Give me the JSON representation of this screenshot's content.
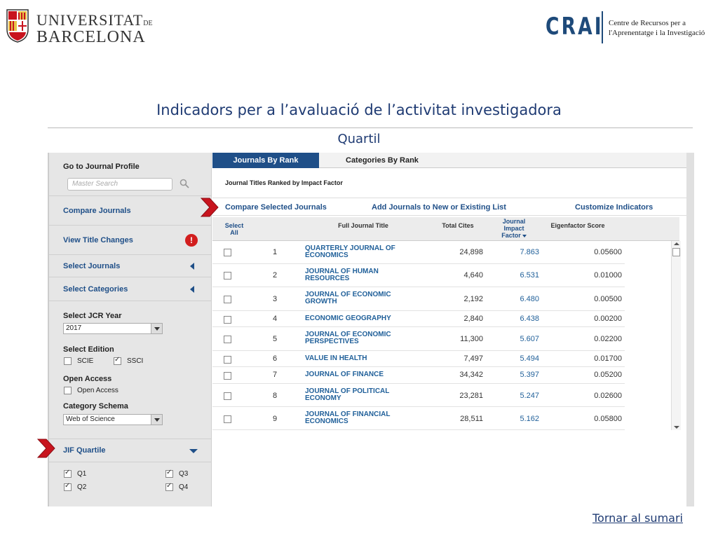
{
  "header": {
    "ub_line1": "UNIVERSITAT",
    "ub_de": "DE",
    "ub_line2": "BARCELONA",
    "crai_mark": "CRAI",
    "crai_line1": "Centre de Recursos per a",
    "crai_line2": "l'Aprenentatge i la Investigació"
  },
  "slide": {
    "title": "Indicadors per a l’avaluació de l’activitat investigadora",
    "subtitle": "Quartil",
    "back_link": "Tornar al sumari"
  },
  "sidebar": {
    "go_to_profile": "Go to Journal Profile",
    "search_placeholder": "Master Search",
    "compare_journals": "Compare Journals",
    "view_title_changes": "View Title Changes",
    "alert_glyph": "!",
    "select_journals": "Select Journals",
    "select_categories": "Select Categories",
    "jcr_year_label": "Select JCR Year",
    "jcr_year_value": "2017",
    "edition_label": "Select Edition",
    "edition_options": [
      {
        "label": "SCIE",
        "checked": false
      },
      {
        "label": "SSCI",
        "checked": true
      }
    ],
    "open_access_label": "Open Access",
    "open_access_option": "Open Access",
    "category_schema_label": "Category Schema",
    "category_schema_value": "Web of Science",
    "jif_quartile": "JIF Quartile",
    "quartiles": [
      {
        "label": "Q1",
        "checked": true
      },
      {
        "label": "Q3",
        "checked": true
      },
      {
        "label": "Q2",
        "checked": true
      },
      {
        "label": "Q4",
        "checked": true
      }
    ]
  },
  "main": {
    "tab_active": "Journals By Rank",
    "tab_other": "Categories By Rank",
    "ranked_caption": "Journal Titles Ranked by Impact Factor",
    "actions": {
      "compare": "Compare Selected Journals",
      "add": "Add Journals to New or Existing List",
      "customize": "Customize Indicators"
    },
    "columns": {
      "select_line1": "Select",
      "select_line2": "All",
      "title": "Full Journal Title",
      "cites": "Total Cites",
      "jif_line1": "Journal",
      "jif_line2": "Impact",
      "jif_line3": "Factor",
      "eigen": "Eigenfactor Score"
    },
    "rows": [
      {
        "rank": "1",
        "title_line1": "QUARTERLY JOURNAL OF",
        "title_line2": "ECONOMICS",
        "cites": "24,898",
        "jif": "7.863",
        "eigen": "0.05600"
      },
      {
        "rank": "2",
        "title_line1": "JOURNAL OF HUMAN",
        "title_line2": "RESOURCES",
        "cites": "4,640",
        "jif": "6.531",
        "eigen": "0.01000"
      },
      {
        "rank": "3",
        "title_line1": "JOURNAL OF ECONOMIC",
        "title_line2": "GROWTH",
        "cites": "2,192",
        "jif": "6.480",
        "eigen": "0.00500"
      },
      {
        "rank": "4",
        "title_line1": "ECONOMIC GEOGRAPHY",
        "title_line2": "",
        "cites": "2,840",
        "jif": "6.438",
        "eigen": "0.00200"
      },
      {
        "rank": "5",
        "title_line1": "JOURNAL OF ECONOMIC",
        "title_line2": "PERSPECTIVES",
        "cites": "11,300",
        "jif": "5.607",
        "eigen": "0.02200"
      },
      {
        "rank": "6",
        "title_line1": "VALUE IN HEALTH",
        "title_line2": "",
        "cites": "7,497",
        "jif": "5.494",
        "eigen": "0.01700"
      },
      {
        "rank": "7",
        "title_line1": "JOURNAL OF FINANCE",
        "title_line2": "",
        "cites": "34,342",
        "jif": "5.397",
        "eigen": "0.05200"
      },
      {
        "rank": "8",
        "title_line1": "JOURNAL OF POLITICAL",
        "title_line2": "ECONOMY",
        "cites": "23,281",
        "jif": "5.247",
        "eigen": "0.02600"
      },
      {
        "rank": "9",
        "title_line1": "JOURNAL OF FINANCIAL",
        "title_line2": "ECONOMICS",
        "cites": "28,511",
        "jif": "5.162",
        "eigen": "0.05800"
      }
    ]
  },
  "colors": {
    "brand_blue": "#1f4f88",
    "title_blue": "#1f3b73",
    "alert_red": "#d21e1e",
    "arrow_red": "#c8141e"
  }
}
